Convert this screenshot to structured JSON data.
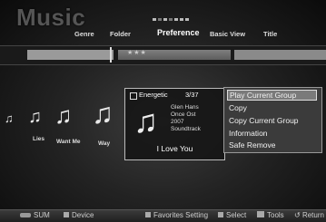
{
  "header": {
    "title": "Music",
    "tabs": [
      "Genre",
      "Folder",
      "Preference",
      "Basic View",
      "Title"
    ]
  },
  "rating": {
    "stars": "★★★"
  },
  "albums": [
    {
      "label": ""
    },
    {
      "label": "Lies"
    },
    {
      "label": "Want Me"
    },
    {
      "label": "Way"
    }
  ],
  "card": {
    "category": "Energetic",
    "count": "3/37",
    "artist": "Glen Hans",
    "album": "Once Ost",
    "year": "2007",
    "genre": "Soundtrack",
    "song": "I Love You"
  },
  "menu": {
    "items": [
      "Play Current Group",
      "Copy",
      "Copy Current Group",
      "Information",
      "Safe Remove"
    ],
    "selected_index": 0
  },
  "bottom_bar": {
    "sum": "SUM",
    "device": "Device",
    "favorites": "Favorites Setting",
    "select": "Select",
    "tools": "Tools",
    "return": "Return"
  },
  "icons": {
    "note": "♫"
  }
}
